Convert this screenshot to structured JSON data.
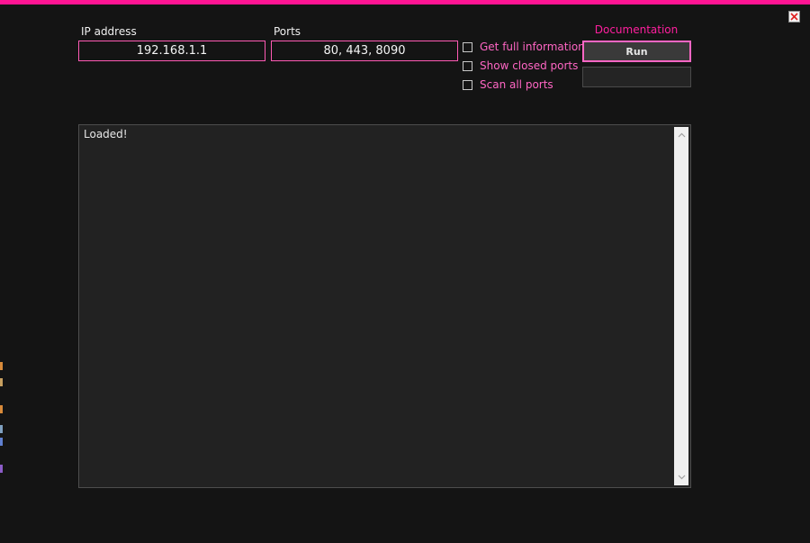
{
  "window": {
    "accent_color": "#ff1493",
    "close_icon": "close-icon"
  },
  "form": {
    "ip_label": "IP address",
    "ip_value": "192.168.1.1",
    "ports_label": "Ports",
    "ports_value": "80, 443, 8090"
  },
  "options": [
    {
      "label": "Get full information",
      "checked": false
    },
    {
      "label": "Show closed ports",
      "checked": false
    },
    {
      "label": "Scan all ports",
      "checked": false
    }
  ],
  "actions": {
    "documentation_label": "Documentation",
    "run_label": "Run",
    "progress_value": 0
  },
  "output": {
    "text": "Loaded!"
  }
}
